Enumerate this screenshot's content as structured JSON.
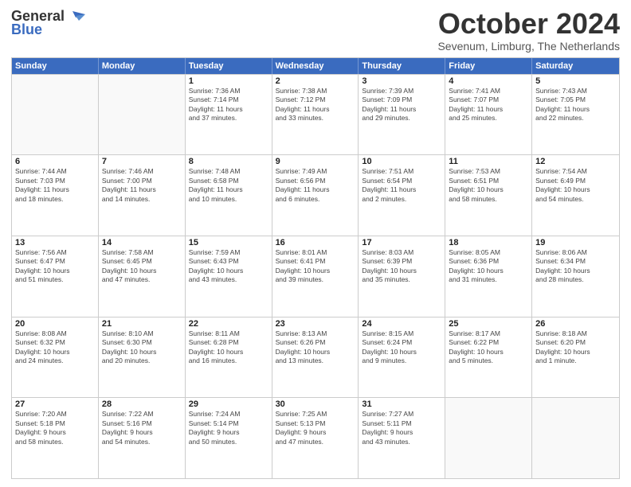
{
  "header": {
    "logo_line1": "General",
    "logo_line2": "Blue",
    "month_title": "October 2024",
    "location": "Sevenum, Limburg, The Netherlands"
  },
  "weekdays": [
    "Sunday",
    "Monday",
    "Tuesday",
    "Wednesday",
    "Thursday",
    "Friday",
    "Saturday"
  ],
  "rows": [
    [
      {
        "day": "",
        "info": ""
      },
      {
        "day": "",
        "info": ""
      },
      {
        "day": "1",
        "info": "Sunrise: 7:36 AM\nSunset: 7:14 PM\nDaylight: 11 hours\nand 37 minutes."
      },
      {
        "day": "2",
        "info": "Sunrise: 7:38 AM\nSunset: 7:12 PM\nDaylight: 11 hours\nand 33 minutes."
      },
      {
        "day": "3",
        "info": "Sunrise: 7:39 AM\nSunset: 7:09 PM\nDaylight: 11 hours\nand 29 minutes."
      },
      {
        "day": "4",
        "info": "Sunrise: 7:41 AM\nSunset: 7:07 PM\nDaylight: 11 hours\nand 25 minutes."
      },
      {
        "day": "5",
        "info": "Sunrise: 7:43 AM\nSunset: 7:05 PM\nDaylight: 11 hours\nand 22 minutes."
      }
    ],
    [
      {
        "day": "6",
        "info": "Sunrise: 7:44 AM\nSunset: 7:03 PM\nDaylight: 11 hours\nand 18 minutes."
      },
      {
        "day": "7",
        "info": "Sunrise: 7:46 AM\nSunset: 7:00 PM\nDaylight: 11 hours\nand 14 minutes."
      },
      {
        "day": "8",
        "info": "Sunrise: 7:48 AM\nSunset: 6:58 PM\nDaylight: 11 hours\nand 10 minutes."
      },
      {
        "day": "9",
        "info": "Sunrise: 7:49 AM\nSunset: 6:56 PM\nDaylight: 11 hours\nand 6 minutes."
      },
      {
        "day": "10",
        "info": "Sunrise: 7:51 AM\nSunset: 6:54 PM\nDaylight: 11 hours\nand 2 minutes."
      },
      {
        "day": "11",
        "info": "Sunrise: 7:53 AM\nSunset: 6:51 PM\nDaylight: 10 hours\nand 58 minutes."
      },
      {
        "day": "12",
        "info": "Sunrise: 7:54 AM\nSunset: 6:49 PM\nDaylight: 10 hours\nand 54 minutes."
      }
    ],
    [
      {
        "day": "13",
        "info": "Sunrise: 7:56 AM\nSunset: 6:47 PM\nDaylight: 10 hours\nand 51 minutes."
      },
      {
        "day": "14",
        "info": "Sunrise: 7:58 AM\nSunset: 6:45 PM\nDaylight: 10 hours\nand 47 minutes."
      },
      {
        "day": "15",
        "info": "Sunrise: 7:59 AM\nSunset: 6:43 PM\nDaylight: 10 hours\nand 43 minutes."
      },
      {
        "day": "16",
        "info": "Sunrise: 8:01 AM\nSunset: 6:41 PM\nDaylight: 10 hours\nand 39 minutes."
      },
      {
        "day": "17",
        "info": "Sunrise: 8:03 AM\nSunset: 6:39 PM\nDaylight: 10 hours\nand 35 minutes."
      },
      {
        "day": "18",
        "info": "Sunrise: 8:05 AM\nSunset: 6:36 PM\nDaylight: 10 hours\nand 31 minutes."
      },
      {
        "day": "19",
        "info": "Sunrise: 8:06 AM\nSunset: 6:34 PM\nDaylight: 10 hours\nand 28 minutes."
      }
    ],
    [
      {
        "day": "20",
        "info": "Sunrise: 8:08 AM\nSunset: 6:32 PM\nDaylight: 10 hours\nand 24 minutes."
      },
      {
        "day": "21",
        "info": "Sunrise: 8:10 AM\nSunset: 6:30 PM\nDaylight: 10 hours\nand 20 minutes."
      },
      {
        "day": "22",
        "info": "Sunrise: 8:11 AM\nSunset: 6:28 PM\nDaylight: 10 hours\nand 16 minutes."
      },
      {
        "day": "23",
        "info": "Sunrise: 8:13 AM\nSunset: 6:26 PM\nDaylight: 10 hours\nand 13 minutes."
      },
      {
        "day": "24",
        "info": "Sunrise: 8:15 AM\nSunset: 6:24 PM\nDaylight: 10 hours\nand 9 minutes."
      },
      {
        "day": "25",
        "info": "Sunrise: 8:17 AM\nSunset: 6:22 PM\nDaylight: 10 hours\nand 5 minutes."
      },
      {
        "day": "26",
        "info": "Sunrise: 8:18 AM\nSunset: 6:20 PM\nDaylight: 10 hours\nand 1 minute."
      }
    ],
    [
      {
        "day": "27",
        "info": "Sunrise: 7:20 AM\nSunset: 5:18 PM\nDaylight: 9 hours\nand 58 minutes."
      },
      {
        "day": "28",
        "info": "Sunrise: 7:22 AM\nSunset: 5:16 PM\nDaylight: 9 hours\nand 54 minutes."
      },
      {
        "day": "29",
        "info": "Sunrise: 7:24 AM\nSunset: 5:14 PM\nDaylight: 9 hours\nand 50 minutes."
      },
      {
        "day": "30",
        "info": "Sunrise: 7:25 AM\nSunset: 5:13 PM\nDaylight: 9 hours\nand 47 minutes."
      },
      {
        "day": "31",
        "info": "Sunrise: 7:27 AM\nSunset: 5:11 PM\nDaylight: 9 hours\nand 43 minutes."
      },
      {
        "day": "",
        "info": ""
      },
      {
        "day": "",
        "info": ""
      }
    ]
  ]
}
